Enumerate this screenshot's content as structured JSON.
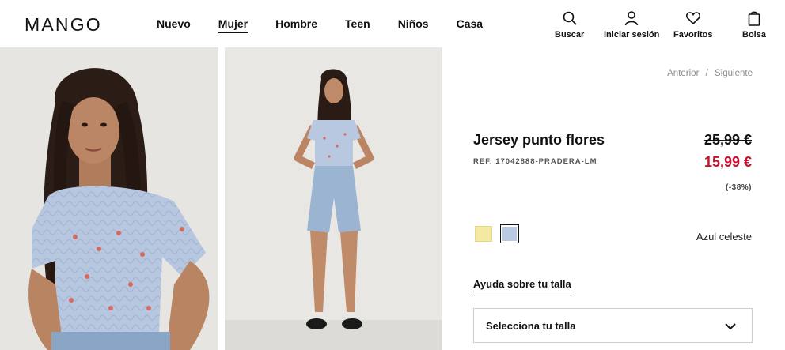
{
  "brand": "MANGO",
  "nav": [
    "Nuevo",
    "Mujer",
    "Hombre",
    "Teen",
    "Niños",
    "Casa"
  ],
  "active_nav": "Mujer",
  "utils": {
    "search": "Buscar",
    "login": "Iniciar sesión",
    "favorites": "Favoritos",
    "bag": "Bolsa"
  },
  "pager": {
    "prev": "Anterior",
    "sep": "/",
    "next": "Siguiente"
  },
  "product": {
    "title": "Jersey punto flores",
    "ref": "REF. 17042888-PRADERA-LM",
    "old_price": "25,99 €",
    "new_price": "15,99 €",
    "discount": "(-38%)",
    "color_name": "Azul celeste",
    "size_help": "Ayuda sobre tu talla",
    "size_select": "Selecciona tu talla"
  },
  "colors": {
    "sale": "#c8102e",
    "swatch_yellow": "#f3e9a3",
    "swatch_blue": "#b9cbe3"
  }
}
